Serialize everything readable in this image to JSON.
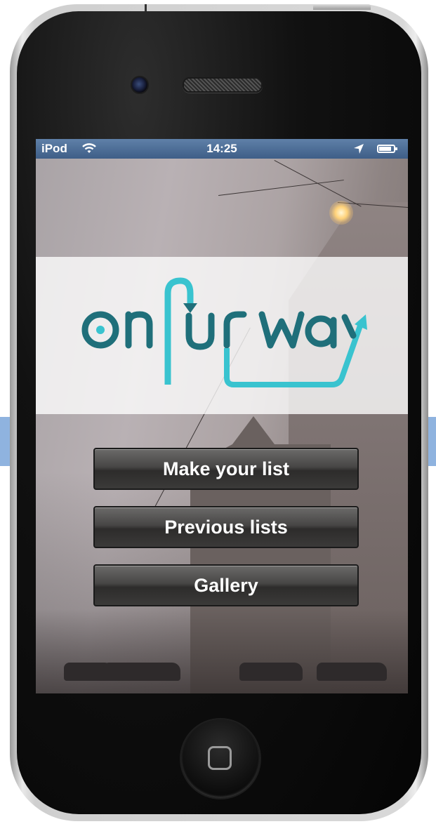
{
  "status_bar": {
    "carrier": "iPod",
    "time": "14:25",
    "wifi_icon": "wifi-icon",
    "location_icon": "location-arrow-icon",
    "battery_icon": "battery-icon",
    "battery_level": 0.85
  },
  "logo": {
    "text": "OnUrWay",
    "colors": {
      "dark": "#1f6f7a",
      "light": "#39c3cf"
    }
  },
  "menu": {
    "make_list_label": "Make your list",
    "previous_lists_label": "Previous lists",
    "gallery_label": "Gallery"
  },
  "device": {
    "home_button_icon": "home-button-icon",
    "camera_icon": "front-camera-icon",
    "speaker_icon": "speaker-grille-icon"
  },
  "colors": {
    "status_bar": "#4a6a94",
    "button_text": "#ffffff",
    "side_panel": "#8fb3df"
  }
}
